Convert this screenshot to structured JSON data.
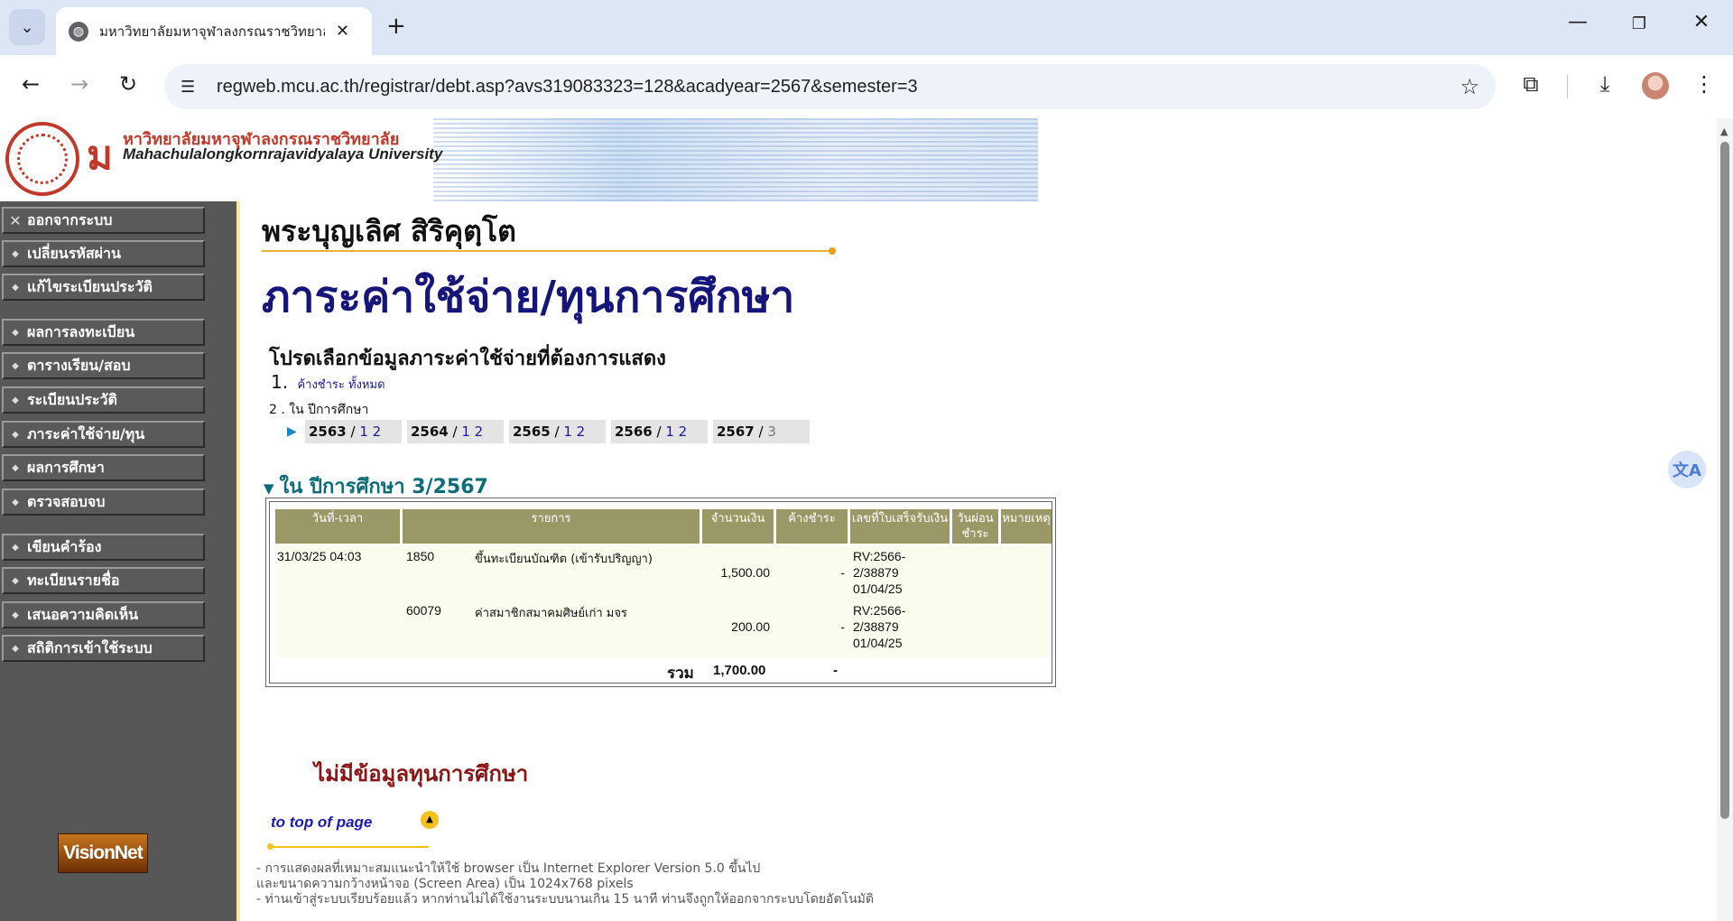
{
  "browser": {
    "tab_title": "มหาวิทยาลัยมหาจุฬาลงกรณราชวิทยาลัย",
    "url": "regweb.mcu.ac.th/registrar/debt.asp?avs319083323=128&acadyear=2567&semester=3"
  },
  "icons": {
    "tab_search": "chevron-down-icon",
    "favicon": "globe-icon",
    "close": "close-icon",
    "new_tab": "plus-icon",
    "back": "arrow-left-icon",
    "forward": "arrow-right-icon",
    "reload": "reload-icon",
    "site_info": "tune-icon",
    "bookmark": "star-icon",
    "extensions": "puzzle-icon",
    "download": "download-icon",
    "menu": "kebab-menu-icon",
    "translate": "translate-icon"
  },
  "banner": {
    "logo_letter": "ม",
    "university_th": "หาวิทยาลัยมหาจุฬาลงกรณราชวิทยาลัย",
    "university_en": "Mahachulalongkornrajavidyalaya University"
  },
  "sidebar": {
    "items": [
      {
        "label": "ออกจากระบบ",
        "bullet": "✕"
      },
      {
        "label": "เปลี่ยนรหัสผ่าน",
        "bullet": "◆"
      },
      {
        "label": "แก้ไขระเบียนประวัติ",
        "bullet": "◆"
      },
      {
        "label": "ผลการลงทะเบียน",
        "bullet": "◆"
      },
      {
        "label": "ตารางเรียน/สอบ",
        "bullet": "◆"
      },
      {
        "label": "ระเบียนประวัติ",
        "bullet": "◆"
      },
      {
        "label": "ภาระค่าใช้จ่าย/ทุน",
        "bullet": "◆"
      },
      {
        "label": "ผลการศึกษา",
        "bullet": "◆"
      },
      {
        "label": "ตรวจสอบจบ",
        "bullet": "◆"
      },
      {
        "label": "เขียนคำร้อง",
        "bullet": "◆"
      },
      {
        "label": "ทะเบียนรายชื่อ",
        "bullet": "◆"
      },
      {
        "label": "เสนอความคิดเห็น",
        "bullet": "◆"
      },
      {
        "label": "สถิติการเข้าใช้ระบบ",
        "bullet": "◆"
      }
    ],
    "footer_logo": "VisionNet"
  },
  "main": {
    "student_name": "พระบุญเลิศ สิริคุตฺโต",
    "page_title": "ภาระค่าใช้จ่าย/ทุนการศึกษา",
    "prompt": "โปรดเลือกข้อมูลภาระค่าใช้จ่ายที่ต้องการแสดง",
    "option1_num": "1.",
    "option1_link": "ค้างชำระ ทั้งหมด",
    "option2": "2 . ใน ปีการศึกษา",
    "years": [
      {
        "year": "2563",
        "sep": " / ",
        "sems": "1 2"
      },
      {
        "year": "2564",
        "sep": " / ",
        "sems": "1 2"
      },
      {
        "year": "2565",
        "sep": " / ",
        "sems": "1 2"
      },
      {
        "year": "2566",
        "sep": " / ",
        "sems": "1 2"
      },
      {
        "year": "2567",
        "sep": " / ",
        "sems": "3"
      }
    ],
    "section_title": "ใน ปีการศึกษา 3/2567"
  },
  "table": {
    "headers": [
      "วันที่-เวลา",
      "รายการ",
      "จำนวนเงิน",
      "ค้างชำระ",
      "เลขที่ใบเสร็จรับเงิน",
      "วันผ่อน ชำระ",
      "หมายเหตุ"
    ],
    "rows": [
      {
        "datetime": "31/03/25 04:03",
        "code": "1850",
        "item": "ขึ้นทะเบียนบัณฑิต (เข้ารับปริญญา)",
        "amount": "1,500.00",
        "outstanding": "-",
        "receipt_1": "RV:2566-",
        "receipt_2": "2/38879",
        "receipt_3": "01/04/25"
      },
      {
        "datetime": "",
        "code": "60079",
        "item": "ค่าสมาชิกสมาคมศิษย์เก่า มจร",
        "amount": "200.00",
        "outstanding": "-",
        "receipt_1": "RV:2566-",
        "receipt_2": "2/38879",
        "receipt_3": "01/04/25"
      }
    ],
    "total_label": "รวม",
    "total_amount": "1,700.00",
    "total_outstanding": "-"
  },
  "scholarship": {
    "no_data": "ไม่มีข้อมูลทุนการศึกษา"
  },
  "footer": {
    "top_link": "to top of page",
    "notes": [
      "- การแสดงผลที่เหมาะสมแนะนำให้ใช้ browser เป็น Internet Explorer Version 5.0 ขึ้นไป",
      "  และขนาดความกว้างหน้าจอ (Screen Area) เป็น 1024x768 pixels",
      "- ท่านเข้าสู่ระบบเรียบร้อยแล้ว หากท่านไม่ได้ใช้งานระบบนานเกิน 15 นาที ท่านจึงถูกให้ออกจากระบบโดยอัตโนมัติ"
    ]
  }
}
